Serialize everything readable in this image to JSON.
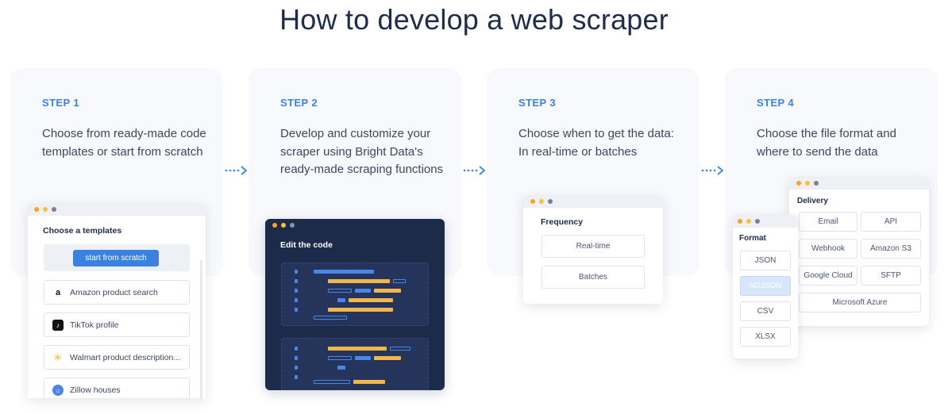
{
  "title": "How to develop a web scraper",
  "steps": [
    {
      "label": "STEP 1",
      "desc": "Choose from ready-made code templates or start from scratch"
    },
    {
      "label": "STEP 2",
      "desc": "Develop and customize your scraper using Bright Data's ready-made scraping functions"
    },
    {
      "label": "STEP 3",
      "desc": "Choose when to get the data: In real-time or batches"
    },
    {
      "label": "STEP 4",
      "desc": "Choose the file format and where to send the data"
    }
  ],
  "templates": {
    "title": "Choose a templates",
    "start_button": "start from scratch",
    "items": [
      {
        "label": "Amazon product search",
        "icon": "amazon-icon"
      },
      {
        "label": "TikTok profile",
        "icon": "tiktok-icon"
      },
      {
        "label": "Walmart product description...",
        "icon": "walmart-icon"
      },
      {
        "label": "Zillow houses",
        "icon": "zillow-icon"
      }
    ]
  },
  "code_editor": {
    "title": "Edit the code"
  },
  "frequency": {
    "title": "Frequency",
    "options": [
      "Real-time",
      "Batches"
    ]
  },
  "format": {
    "title": "Format",
    "options": [
      "JSON",
      "NDJSON",
      "CSV",
      "XLSX"
    ],
    "selected": "NDJSON"
  },
  "delivery": {
    "title": "Delivery",
    "options": [
      "Email",
      "API",
      "Webhook",
      "Amazon S3",
      "Google Cloud",
      "SFTP",
      "Microsoft Azure"
    ]
  },
  "colors": {
    "accent": "#3b82e0",
    "code_bg": "#1d2b4a",
    "code_orange": "#f3b64c",
    "code_blue": "#4a86e8"
  }
}
